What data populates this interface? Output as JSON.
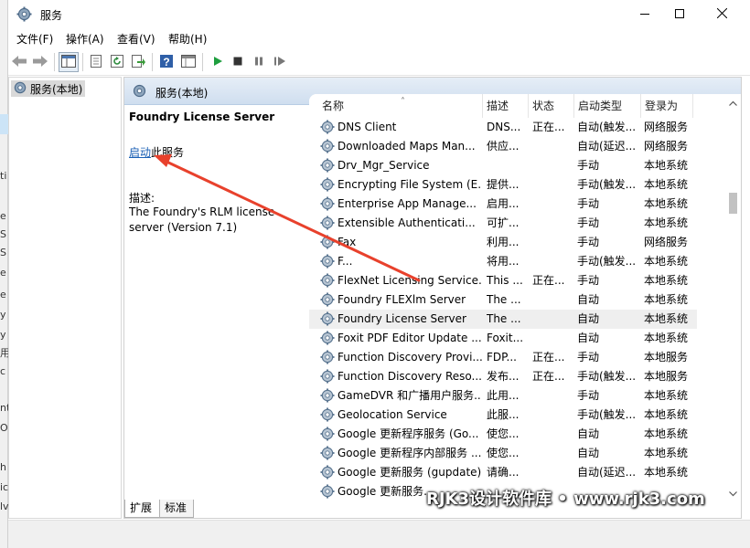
{
  "window": {
    "title": "服务",
    "controls": {
      "minimize": "minimize-icon",
      "maximize": "maximize-icon",
      "close": "close-icon"
    }
  },
  "background_window": {
    "fragments": [
      "ti",
      "e",
      "S",
      "S",
      "e",
      "e",
      "y",
      "y",
      "用",
      "c",
      "nt",
      "O",
      "h",
      "ic",
      "lv"
    ]
  },
  "menu": [
    "文件(F)",
    "操作(A)",
    "查看(V)",
    "帮助(H)"
  ],
  "toolbar": {
    "buttons": [
      "back-icon",
      "forward-icon",
      "show-tree-icon",
      "properties-icon",
      "refresh-icon",
      "export-icon",
      "help-icon",
      "console-icon",
      "start-service-icon",
      "stop-service-icon",
      "pause-service-icon",
      "restart-service-icon"
    ]
  },
  "tree": {
    "root_label": "服务(本地)"
  },
  "content": {
    "header_title": "服务(本地)",
    "detail": {
      "service_name": "Foundry License Server",
      "start_link": "启动",
      "start_suffix": "此服务",
      "desc_label": "描述:",
      "desc_text": "The Foundry's RLM license server (Version 7.1)"
    },
    "columns": {
      "name": "名称",
      "desc": "描述",
      "state": "状态",
      "startup": "启动类型",
      "logon": "登录为"
    },
    "rows": [
      {
        "name": "DNS Client",
        "desc": "DNS...",
        "state": "正在...",
        "startup": "自动(触发...",
        "logon": "网络服务"
      },
      {
        "name": "Downloaded Maps Man...",
        "desc": "供应...",
        "state": "",
        "startup": "自动(延迟...",
        "logon": "网络服务"
      },
      {
        "name": "Drv_Mgr_Service",
        "desc": "",
        "state": "",
        "startup": "手动",
        "logon": "本地系统"
      },
      {
        "name": "Encrypting File System (E...",
        "desc": "提供...",
        "state": "",
        "startup": "手动(触发...",
        "logon": "本地系统"
      },
      {
        "name": "Enterprise App Manage...",
        "desc": "启用...",
        "state": "",
        "startup": "手动",
        "logon": "本地系统"
      },
      {
        "name": "Extensible Authenticati...",
        "desc": "可扩...",
        "state": "",
        "startup": "手动",
        "logon": "本地系统"
      },
      {
        "name": "Fax",
        "desc": "利用...",
        "state": "",
        "startup": "手动",
        "logon": "网络服务"
      },
      {
        "name": "F...",
        "desc": "将用...",
        "state": "",
        "startup": "手动(触发...",
        "logon": "本地系统"
      },
      {
        "name": "FlexNet Licensing Service...",
        "desc": "This ...",
        "state": "正在...",
        "startup": "手动",
        "logon": "本地系统"
      },
      {
        "name": "Foundry FLEXlm Server",
        "desc": "The ...",
        "state": "",
        "startup": "自动",
        "logon": "本地系统"
      },
      {
        "name": "Foundry License Server",
        "desc": "The ...",
        "state": "",
        "startup": "自动",
        "logon": "本地系统",
        "selected": true
      },
      {
        "name": "Foxit PDF Editor Update ...",
        "desc": "Foxit...",
        "state": "",
        "startup": "自动",
        "logon": "本地系统"
      },
      {
        "name": "Function Discovery Provi...",
        "desc": "FDP...",
        "state": "正在...",
        "startup": "手动",
        "logon": "本地服务"
      },
      {
        "name": "Function Discovery Reso...",
        "desc": "发布...",
        "state": "正在...",
        "startup": "手动(触发...",
        "logon": "本地服务"
      },
      {
        "name": "GameDVR 和广播用户服务...",
        "desc": "此用...",
        "state": "",
        "startup": "手动",
        "logon": "本地系统"
      },
      {
        "name": "Geolocation Service",
        "desc": "此服...",
        "state": "",
        "startup": "手动(触发...",
        "logon": "本地系统"
      },
      {
        "name": "Google 更新程序服务 (Go...",
        "desc": "使您...",
        "state": "",
        "startup": "自动",
        "logon": "本地系统"
      },
      {
        "name": "Google 更新程序内部服务 ...",
        "desc": "使您...",
        "state": "",
        "startup": "自动",
        "logon": "本地系统"
      },
      {
        "name": "Google 更新服务 (gupdate)",
        "desc": "请确...",
        "state": "",
        "startup": "自动(延迟...",
        "logon": "本地系统"
      },
      {
        "name": "Google 更新服务...",
        "desc": "",
        "state": "",
        "startup": "",
        "logon": ""
      }
    ],
    "tabs": [
      "扩展",
      "标准"
    ]
  },
  "watermark": "RJK3设计软件库 • www.rjk3.com",
  "colors": {
    "link": "#1a5fb4",
    "arrow": "#e8412c",
    "header_gradient": "#cfdeef"
  }
}
